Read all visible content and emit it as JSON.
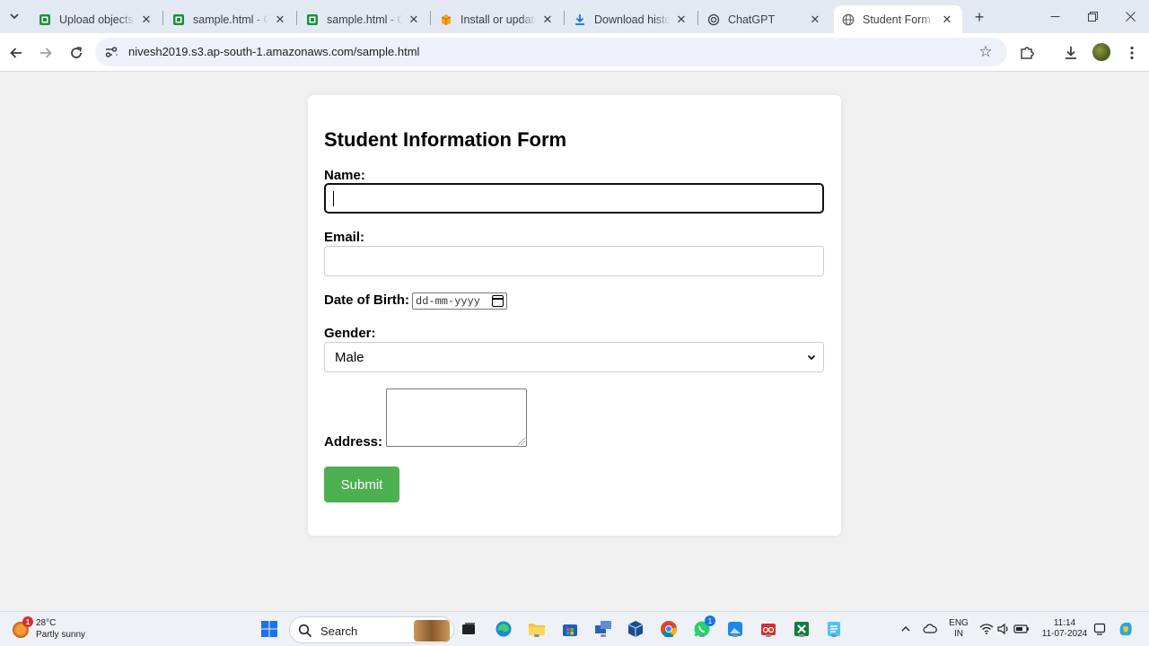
{
  "browser": {
    "tabs": [
      {
        "title": "Upload objects -",
        "icon": "green-sheet-icon",
        "active": false
      },
      {
        "title": "sample.html - Ob",
        "icon": "green-sheet-icon",
        "active": false
      },
      {
        "title": "sample.html - Ob",
        "icon": "green-sheet-icon",
        "active": false
      },
      {
        "title": "Install or update",
        "icon": "orange-box-icon",
        "active": false
      },
      {
        "title": "Download history",
        "icon": "download-icon",
        "active": false
      },
      {
        "title": "ChatGPT",
        "icon": "chatgpt-icon",
        "active": false
      },
      {
        "title": "Student Form",
        "icon": "globe-icon",
        "active": true
      }
    ],
    "url": "nivesh2019.s3.ap-south-1.amazonaws.com/sample.html"
  },
  "form": {
    "title": "Student Information Form",
    "name_label": "Name:",
    "name_value": "",
    "email_label": "Email:",
    "email_value": "",
    "dob_label": "Date of Birth:",
    "dob_placeholder": "dd-mm-yyyy",
    "gender_label": "Gender:",
    "gender_selected": "Male",
    "address_label": "Address:",
    "submit_label": "Submit",
    "accent_color": "#4caf50"
  },
  "taskbar": {
    "weather_temp": "28°C",
    "weather_condition": "Partly sunny",
    "weather_badge": "1",
    "search_label": "Search",
    "whatsapp_badge": "1",
    "lang_line1": "ENG",
    "lang_line2": "IN",
    "time": "11:14",
    "date": "11-07-2024"
  }
}
